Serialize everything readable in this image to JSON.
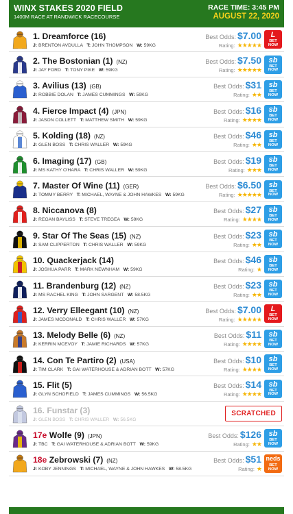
{
  "header": {
    "title": "WINX STAKES 2020 FIELD",
    "subtitle": "1400M RACE AT RANDWICK RACECOURSE",
    "race_time": "RACE TIME: 3:45 PM",
    "date": "AUGUST 22, 2020"
  },
  "labels": {
    "best_odds": "Best Odds:",
    "rating": "Rating:",
    "bet": "BET",
    "now": "NOW",
    "scratched": "SCRATCHED"
  },
  "colors": {
    "header_green": "#26781f",
    "date_yellow": "#f7d21b",
    "odds_blue": "#2c8bd4",
    "star": "#f5b400",
    "sportsbet": "#2e9ee6",
    "ladbrokes": "#e4191d",
    "neds": "#f26b12",
    "scratched_red": "#e02020"
  },
  "runners": [
    {
      "name": "1. Dreamforce (16)",
      "country": "",
      "jockey": "BRENTON AVDULLA",
      "trainer": "JOHN THOMPSON",
      "weight": "59KG",
      "odds": "$7.00",
      "stars": "★★★★★",
      "bookie": "lad",
      "logo": "L",
      "silk": [
        "#f2a81d",
        "#f2a81d",
        "#c47a10"
      ]
    },
    {
      "name": "2. The Bostonian (1)",
      "country": "(NZ)",
      "jockey": "JAY FORD",
      "trainer": "TONY PIKE",
      "weight": "59KG",
      "odds": "$7.50",
      "stars": "★★★★★",
      "bookie": "sb",
      "logo": "sb",
      "silk": [
        "#2a3a8c",
        "#ffffff",
        "#2a3a8c"
      ]
    },
    {
      "name": "3. Avilius (13)",
      "country": "(GB)",
      "jockey": "ROBBIE DOLAN",
      "trainer": "JAMES CUMMINGS",
      "weight": "59KG",
      "odds": "$31",
      "stars": "★★",
      "bookie": "sb",
      "logo": "sb",
      "silk": [
        "#2a5fcf",
        "#2a5fcf",
        "#ffffff"
      ]
    },
    {
      "name": "4. Fierce Impact (4)",
      "country": "(JPN)",
      "jockey": "JASON COLLETT",
      "trainer": "MATTHEW SMITH",
      "weight": "59KG",
      "odds": "$16",
      "stars": "★★★★",
      "bookie": "sb",
      "logo": "sb",
      "silk": [
        "#8a1b3a",
        "#c9c9c9",
        "#8a1b3a"
      ]
    },
    {
      "name": "5. Kolding (18)",
      "country": "(NZ)",
      "jockey": "GLEN BOSS",
      "trainer": "CHRIS WALLER",
      "weight": "59KG",
      "odds": "$46",
      "stars": "★★",
      "bookie": "sb",
      "logo": "sb",
      "silk": [
        "#ffffff",
        "#4a7bd0",
        "#ffffff"
      ]
    },
    {
      "name": "6. Imaging (17)",
      "country": "(GB)",
      "jockey": "MS KATHY O'HARA",
      "trainer": "CHRIS WALLER",
      "weight": "59KG",
      "odds": "$19",
      "stars": "★★★",
      "bookie": "sb",
      "logo": "sb",
      "silk": [
        "#1f8f2e",
        "#ffffff",
        "#1f8f2e"
      ]
    },
    {
      "name": "7. Master Of Wine (11)",
      "country": "(GER)",
      "jockey": "TOMMY BERRY",
      "trainer": "MICHAEL, WAYNE & JOHN HAWKES",
      "weight": "59KG",
      "odds": "$6.50",
      "stars": "★★★★★",
      "bookie": "sb",
      "logo": "sb",
      "silk": [
        "#1a2f8a",
        "#1a2f8a",
        "#f2c400"
      ]
    },
    {
      "name": "8. Niccanova (8)",
      "country": "",
      "jockey": "REGAN BAYLISS",
      "trainer": "STEVE TREGEA",
      "weight": "59KG",
      "odds": "$27",
      "stars": "★★★★",
      "bookie": "sb",
      "logo": "sb",
      "silk": [
        "#e0201d",
        "#ffffff",
        "#e0201d"
      ]
    },
    {
      "name": "9. Star Of The Seas (15)",
      "country": "(NZ)",
      "jockey": "SAM CLIPPERTON",
      "trainer": "CHRIS WALLER",
      "weight": "59KG",
      "odds": "$23",
      "stars": "★★",
      "bookie": "sb",
      "logo": "sb",
      "silk": [
        "#111111",
        "#f2c400",
        "#111111"
      ]
    },
    {
      "name": "10. Quackerjack (14)",
      "country": "",
      "jockey": "JOSHUA PARR",
      "trainer": "MARK NEWNHAM",
      "weight": "59KG",
      "odds": "$46",
      "stars": "★",
      "bookie": "sb",
      "logo": "sb",
      "silk": [
        "#f2c400",
        "#c8102e",
        "#f2c400"
      ]
    },
    {
      "name": "11. Brandenburg (12)",
      "country": "(NZ)",
      "jockey": "MS RACHEL KING",
      "trainer": "JOHN SARGENT",
      "weight": "58.5KG",
      "odds": "$23",
      "stars": "★★",
      "bookie": "sb",
      "logo": "sb",
      "silk": [
        "#0f1f5c",
        "#ffffff",
        "#0f1f5c"
      ]
    },
    {
      "name": "12. Verry Elleegant (10)",
      "country": "(NZ)",
      "jockey": "JAMES MCDONALD",
      "trainer": "CHRIS WALLER",
      "weight": "57KG",
      "odds": "$7.00",
      "stars": "★★★★★",
      "bookie": "lad",
      "logo": "L",
      "silk": [
        "#e0201d",
        "#2a5fcf",
        "#e0201d"
      ]
    },
    {
      "name": "13. Melody Belle (6)",
      "country": "(NZ)",
      "jockey": "KERRIN MCEVOY",
      "trainer": "JAMIE RICHARDS",
      "weight": "57KG",
      "odds": "$11",
      "stars": "★★★★",
      "bookie": "sb",
      "logo": "sb",
      "silk": [
        "#c97a2a",
        "#2a3a8c",
        "#c97a2a"
      ]
    },
    {
      "name": "14. Con Te Partiro (2)",
      "country": "(USA)",
      "jockey": "TIM CLARK",
      "trainer": "GAI WATERHOUSE & ADRIAN BOTT",
      "weight": "57KG",
      "odds": "$10",
      "stars": "★★★★",
      "bookie": "sb",
      "logo": "sb",
      "silk": [
        "#111111",
        "#e0201d",
        "#111111"
      ]
    },
    {
      "name": "15. Flit (5)",
      "country": "",
      "jockey": "GLYN SCHOFIELD",
      "trainer": "JAMES CUMMINGS",
      "weight": "56.5KG",
      "odds": "$14",
      "stars": "★★★★",
      "bookie": "sb",
      "logo": "sb",
      "silk": [
        "#2a5fcf",
        "#2a5fcf",
        "#2a5fcf"
      ]
    },
    {
      "name": "16. Funstar (3)",
      "country": "",
      "jockey": "GLEN BOSS",
      "trainer": "CHRIS WALLER",
      "weight": "56.5KG",
      "odds": "",
      "stars": "",
      "bookie": "scratched",
      "logo": "",
      "silk": [
        "#c3c9e0",
        "#dde2f0",
        "#c3c9e0"
      ]
    },
    {
      "name_em": "17e",
      "name": " Wolfe (9)",
      "country": "(JPN)",
      "jockey": "TBC",
      "trainer": "GAI WATERHOUSE & ADRIAN BOTT",
      "weight": "59KG",
      "odds": "$126",
      "stars": "★★",
      "bookie": "sb",
      "logo": "sb",
      "silk": [
        "#6a2a8a",
        "#f2c400",
        "#6a2a8a"
      ]
    },
    {
      "name_em": "18e",
      "name": " Zebrowski (7)",
      "country": "(NZ)",
      "jockey": "KOBY JENNINGS",
      "trainer": "MICHAEL, WAYNE & JOHN HAWKES",
      "weight": "58.5KG",
      "odds": "$51",
      "stars": "★",
      "bookie": "neds",
      "logo": "neds",
      "silk": [
        "#f2a81d",
        "#f2a81d",
        "#c47a10"
      ]
    }
  ]
}
